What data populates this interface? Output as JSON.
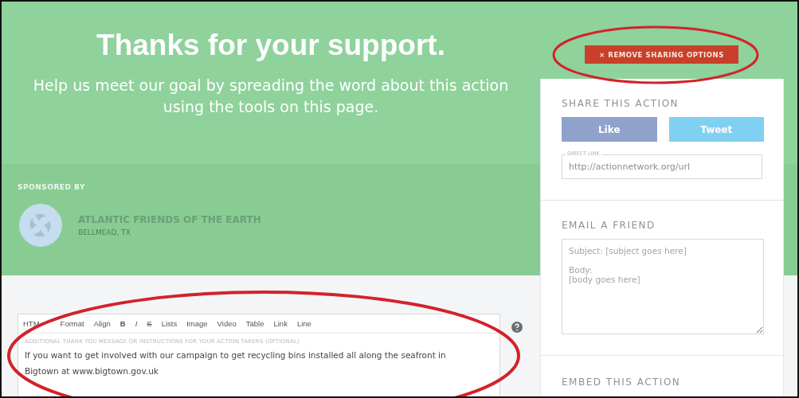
{
  "header": {
    "title": "Thanks for your support.",
    "subtitle": "Help us meet our goal by spreading the word about this action using the tools on this page."
  },
  "sponsor": {
    "label": "SPONSORED BY",
    "name": "ATLANTIC FRIENDS OF THE EARTH",
    "location": "BELLMEAD, TX"
  },
  "editor": {
    "toolbar": [
      "HTM",
      "Format",
      "Align",
      "B",
      "I",
      "S",
      "Lists",
      "Image",
      "Video",
      "Table",
      "Link",
      "Line"
    ],
    "label": "ADDITIONAL THANK YOU MESSAGE OR INSTRUCTIONS FOR YOUR ACTION TAKERS (OPTIONAL)",
    "value": "If you want to get involved with our campaign to get recycling bins installed all along the seafront in Bigtown at www.bigtown.gov.uk"
  },
  "remove_button": "× REMOVE SHARING OPTIONS",
  "share": {
    "heading": "SHARE THIS ACTION",
    "buttons": [
      {
        "kind": "facebook",
        "label": "Like"
      },
      {
        "kind": "twitter",
        "label": "Tweet"
      }
    ],
    "link_label": "DIRECT LINK",
    "link_value": "http://actionnetwork.org/url"
  },
  "email": {
    "heading": "EMAIL A FRIEND",
    "placeholder": "Subject: [subject goes here]\n\nBody:\n[body goes here]"
  },
  "embed": {
    "heading": "EMBED THIS ACTION"
  }
}
